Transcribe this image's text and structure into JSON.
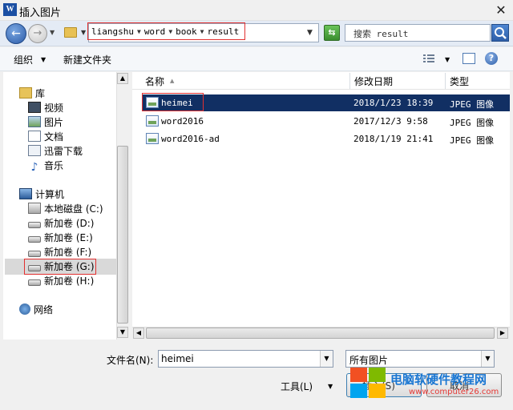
{
  "window": {
    "title": "插入图片",
    "app_icon": "W"
  },
  "nav": {
    "breadcrumbs": [
      "liangshu",
      "word",
      "book",
      "result"
    ],
    "search_placeholder": "搜索 result"
  },
  "toolbar": {
    "organize": "组织",
    "new_folder": "新建文件夹"
  },
  "sidebar": {
    "favorites_header": "库",
    "libraries": [
      {
        "label": "视频",
        "icon": "video-library-icon"
      },
      {
        "label": "图片",
        "icon": "picture-library-icon"
      },
      {
        "label": "文档",
        "icon": "document-library-icon"
      },
      {
        "label": "迅雷下载",
        "icon": "thunder-download-icon"
      },
      {
        "label": "音乐",
        "icon": "music-library-icon"
      }
    ],
    "computer_header": "计算机",
    "drives": [
      {
        "label": "本地磁盘 (C:)"
      },
      {
        "label": "新加卷 (D:)"
      },
      {
        "label": "新加卷 (E:)"
      },
      {
        "label": "新加卷 (F:)"
      },
      {
        "label": "新加卷 (G:)",
        "selected": true
      },
      {
        "label": "新加卷 (H:)"
      }
    ],
    "network": "网络"
  },
  "columns": {
    "name": "名称",
    "date": "修改日期",
    "type": "类型"
  },
  "files": [
    {
      "name": "heimei",
      "date": "2018/1/23 18:39",
      "type": "JPEG 图像",
      "selected": true
    },
    {
      "name": "word2016",
      "date": "2017/12/3 9:58",
      "type": "JPEG 图像"
    },
    {
      "name": "word2016-ad",
      "date": "2018/1/19 21:41",
      "type": "JPEG 图像"
    }
  ],
  "bottom": {
    "filename_label": "文件名(N):",
    "filename_value": "heimei",
    "filetype_value": "所有图片",
    "tools_label": "工具(L)",
    "insert_label": "插入(S)",
    "cancel_label": "取消"
  },
  "watermark": {
    "text": "电脑软硬件教程网",
    "url": "www.computer26.com"
  },
  "colors": {
    "selection": "#112f63",
    "highlight": "#e23030",
    "accent": "#2d5ea8"
  }
}
